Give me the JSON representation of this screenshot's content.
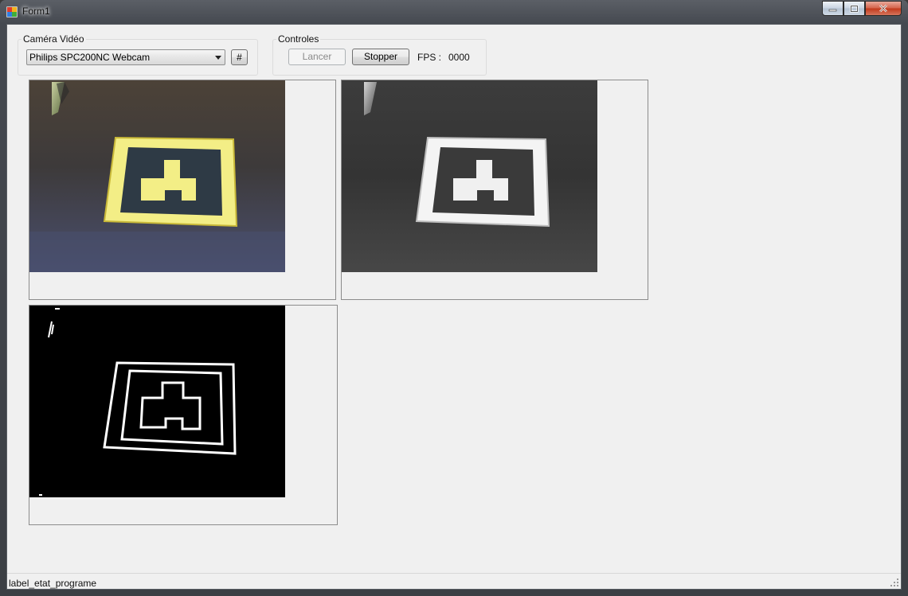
{
  "window": {
    "title": "Form1"
  },
  "camera_group": {
    "legend": "Caméra Vidéo",
    "device_selected": "Philips SPC200NC Webcam",
    "settings_label": "#"
  },
  "controls_group": {
    "legend": "Controles",
    "start_label": "Lancer",
    "stop_label": "Stopper",
    "fps_label": "FPS :",
    "fps_value": "0000"
  },
  "views": [
    {
      "name": "color-camera-view"
    },
    {
      "name": "grayscale-camera-view"
    },
    {
      "name": "edge-detection-view"
    }
  ],
  "status": {
    "label": "label_etat_programe"
  },
  "colors": {
    "window_bg": "#f0f0f0",
    "marker_yellow": "#f3ee86",
    "close_red": "#c2391b"
  }
}
